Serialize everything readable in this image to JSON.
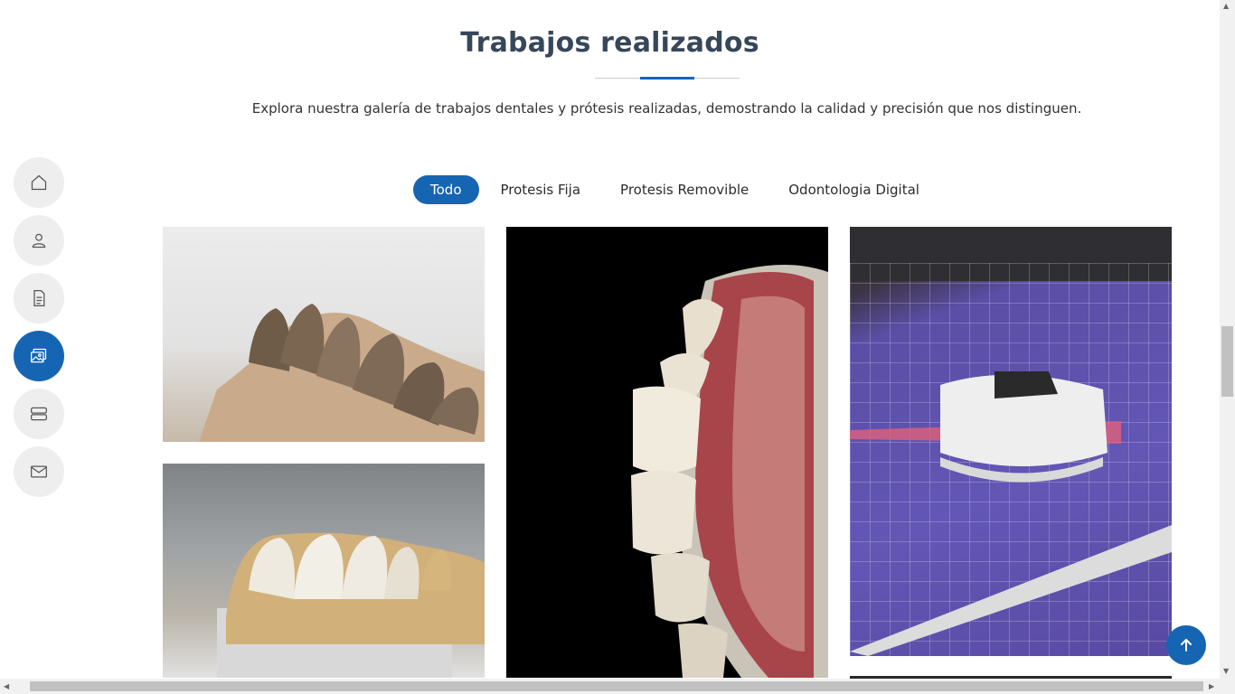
{
  "section": {
    "title": "Trabajos realizados",
    "description": "Explora nuestra galería de trabajos dentales y prótesis realizadas, demostrando la calidad y precisión que nos distinguen."
  },
  "side_nav": {
    "items": [
      {
        "icon": "home-icon",
        "active": false
      },
      {
        "icon": "user-icon",
        "active": false
      },
      {
        "icon": "document-icon",
        "active": false
      },
      {
        "icon": "images-icon",
        "active": true
      },
      {
        "icon": "server-icon",
        "active": false
      },
      {
        "icon": "envelope-icon",
        "active": false
      }
    ]
  },
  "filters": {
    "items": [
      {
        "label": "Todo",
        "active": true
      },
      {
        "label": "Protesis Fija",
        "active": false
      },
      {
        "label": "Protesis Removible",
        "active": false
      },
      {
        "label": "Odontologia Digital",
        "active": false
      }
    ]
  },
  "colors": {
    "accent": "#1665b3",
    "title": "#37475a"
  }
}
